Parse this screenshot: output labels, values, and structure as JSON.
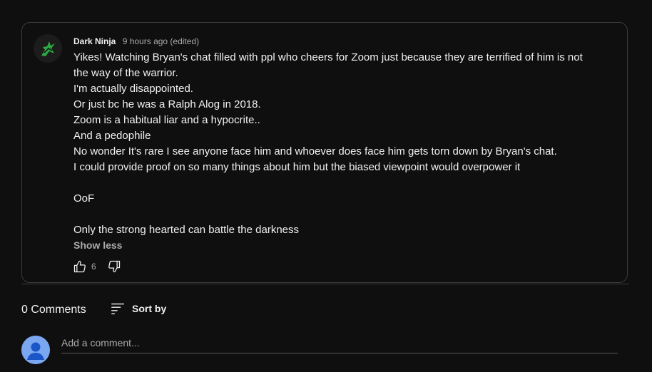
{
  "comment": {
    "author": "Dark Ninja",
    "time": "9 hours ago (edited)",
    "lines": [
      "Yikes! Watching Bryan's chat filled with ppl who cheers for Zoom just because they are terrified of him is not",
      "the way of the warrior.",
      "I'm actually disappointed.",
      "Or just bc he was a Ralph Alog in 2018.",
      "Zoom is a habitual liar and a hypocrite..",
      "And a pedophile",
      "No wonder It's rare I see anyone face him and whoever does face him gets torn down by Bryan's chat.",
      "I could provide proof on so many things about him but the biased viewpoint would overpower it",
      "",
      "OoF",
      "",
      "Only the strong hearted can battle the darkness"
    ],
    "show_less": "Show less",
    "like_count": "6"
  },
  "comments_section": {
    "count_label": "0 Comments",
    "sort_label": "Sort by",
    "add_comment_placeholder": "Add a comment..."
  },
  "icons": {
    "avatar": "ninja-avatar-icon",
    "like": "thumbs-up-icon",
    "dislike": "thumbs-down-icon",
    "sort": "sort-lines-icon",
    "user": "user-avatar-icon"
  },
  "colors": {
    "background": "#0f0f0f",
    "text": "#f1f1f1",
    "secondary_text": "#aaaaaa",
    "border": "#3a3a3a",
    "user_avatar": "#7aa7f0",
    "ninja_accent": "#2fbf4a"
  }
}
